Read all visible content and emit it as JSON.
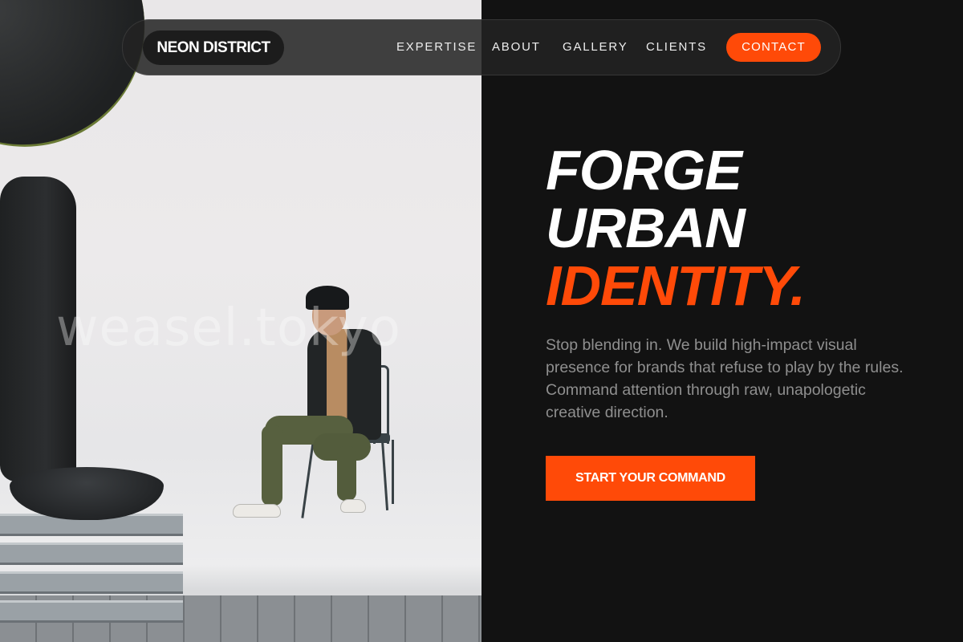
{
  "brand": {
    "logo_text": "NEON DISTRICT",
    "accent_color": "#ff4a08"
  },
  "nav": {
    "links": [
      {
        "label": "EXPERTISE"
      },
      {
        "label": "ABOUT"
      },
      {
        "label": "GALLERY"
      },
      {
        "label": "CLIENTS"
      }
    ],
    "contact_label": "CONTACT"
  },
  "hero": {
    "headline_line1": "FORGE",
    "headline_line2": "URBAN",
    "headline_line3": "IDENTITY.",
    "subcopy": "Stop blending in. We build high-impact visual presence for brands that refuse to play by the rules. Command attention through raw, unapologetic creative direction.",
    "cta_label": "START YOUR COMMAND"
  },
  "photo": {
    "watermark_text": "weasel.tokyo"
  }
}
